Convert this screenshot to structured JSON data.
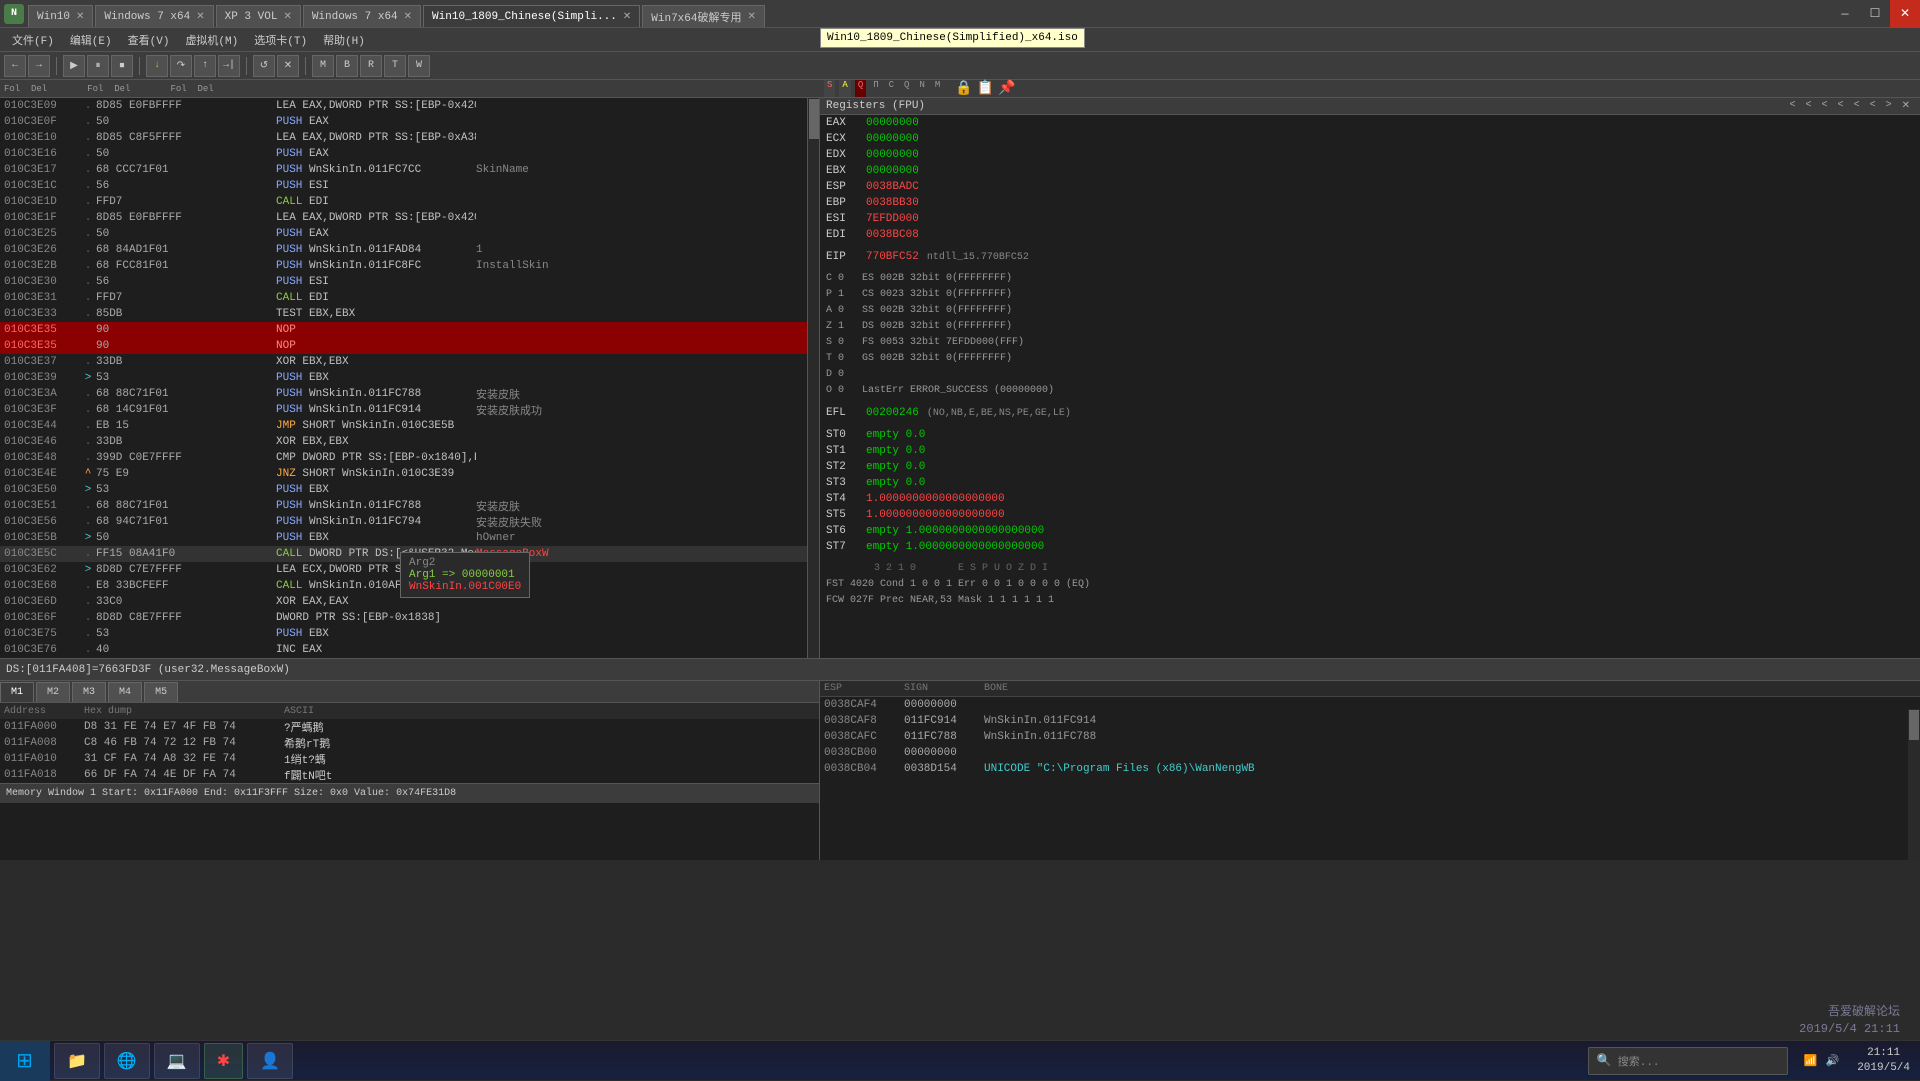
{
  "titlebar": {
    "logo": "N",
    "mode": "NormalMode",
    "tabs": [
      {
        "label": "Win10",
        "active": false
      },
      {
        "label": "Windows 7 x64",
        "active": false
      },
      {
        "label": "XP 3 VOL",
        "active": false
      },
      {
        "label": "Windows 7 x64",
        "active": false
      },
      {
        "label": "Win10_1809_Chinese(Simpli...",
        "active": true
      },
      {
        "label": "Win7x64破解专用",
        "active": false
      }
    ],
    "tooltip": "Win10_1809_Chinese(Simplified)_x64.iso",
    "controls": [
      "—",
      "☐",
      "✕"
    ]
  },
  "menu": {
    "items": [
      "文件(F)",
      "编辑(E)",
      "查看(V)",
      "虚拟机(M)",
      "选项卡(T)",
      "帮助(H)"
    ]
  },
  "col_headers": {
    "fol_del_items": [
      "Fol",
      "Del",
      "Fol",
      "Del",
      "Fol",
      "Del"
    ]
  },
  "registers_panel": {
    "title": "Registers (FPU)",
    "nav_arrows": [
      "<",
      "<",
      "<",
      "<",
      "<",
      "<",
      "<",
      ">"
    ],
    "regs": [
      {
        "name": "EAX",
        "val": "00000000",
        "color": "green"
      },
      {
        "name": "ECX",
        "val": "00000000",
        "color": "green"
      },
      {
        "name": "EDX",
        "val": "00000000",
        "color": "green"
      },
      {
        "name": "EBX",
        "val": "00000000",
        "color": "green"
      },
      {
        "name": "ESP",
        "val": "0038BADC",
        "color": "red"
      },
      {
        "name": "EBP",
        "val": "0038BB30",
        "color": "red"
      },
      {
        "name": "ESI",
        "val": "7EFDD000",
        "color": "red"
      },
      {
        "name": "EDI",
        "val": "0038BC08",
        "color": "red"
      }
    ],
    "eip": {
      "name": "EIP",
      "val": "770BFC52",
      "extra": "ntdll_15.770BFC52"
    },
    "flags": [
      {
        "name": "C 0",
        "detail": "ES 002B 32bit 0(FFFFFFFF)"
      },
      {
        "name": "P 1",
        "detail": "CS 0023 32bit 0(FFFFFFFF)"
      },
      {
        "name": "A 0",
        "detail": "SS 002B 32bit 0(FFFFFFFF)"
      },
      {
        "name": "Z 1",
        "detail": "DS 002B 32bit 0(FFFFFFFF)"
      },
      {
        "name": "S 0",
        "detail": "FS 0053 32bit 7EFDD000(FFF)"
      },
      {
        "name": "T 0",
        "detail": "GS 002B 32bit 0(FFFFFFFF)"
      },
      {
        "name": "D 0",
        "detail": ""
      },
      {
        "name": "O 0",
        "detail": "LastErr ERROR_SUCCESS (00000000)"
      }
    ],
    "efl": {
      "name": "EFL",
      "val": "00200246",
      "extra": "(NO,NB,E,BE,NS,PE,GE,LE)"
    },
    "st_regs": [
      {
        "name": "ST0",
        "val": "empty 0.0"
      },
      {
        "name": "ST1",
        "val": "empty 0.0"
      },
      {
        "name": "ST2",
        "val": "empty 0.0"
      },
      {
        "name": "ST3",
        "val": "empty 0.0"
      },
      {
        "name": "ST4",
        "val": "1.0000000000000000000",
        "color": "red"
      },
      {
        "name": "ST5",
        "val": "1.0000000000000000000",
        "color": "red"
      },
      {
        "name": "ST6",
        "val": "empty 1.0000000000000000000"
      },
      {
        "name": "ST7",
        "val": "empty 1.0000000000000000000"
      }
    ],
    "fst_line": "3 2 1 0       E S P U O Z D I",
    "fst_vals": "FST 4020  Cond 1 0 0 1  Err 0 0 1 0 0 0 0  (EQ)",
    "fcw_vals": "FCW 027F  Prec NEAR,53  Mask   1 1 1 1 1 1"
  },
  "disasm": {
    "lines": [
      {
        "addr": "010C3E09",
        "dot": ".",
        "bytes": "8D85 E0FBFFFF",
        "instr": "LEA EAX,DWORD PTR SS:[EBP-0x420]",
        "comment": ""
      },
      {
        "addr": "010C3E0F",
        "dot": ".",
        "bytes": "50",
        "instr": "PUSH EAX",
        "comment": ""
      },
      {
        "addr": "010C3E10",
        "dot": ".",
        "bytes": "8D85 C8F5FFFF",
        "instr": "LEA EAX,DWORD PTR SS:[EBP-0xA38]",
        "comment": ""
      },
      {
        "addr": "010C3E16",
        "dot": ".",
        "bytes": "50",
        "instr": "PUSH EAX",
        "comment": ""
      },
      {
        "addr": "010C3E17",
        "dot": ".",
        "bytes": "68 CCC71F01",
        "instr": "PUSH WnSkinIn.011FC7CC",
        "comment": "SkinName"
      },
      {
        "addr": "010C3E1C",
        "dot": ".",
        "bytes": "56",
        "instr": "PUSH ESI",
        "comment": ""
      },
      {
        "addr": "010C3E1D",
        "dot": ".",
        "bytes": "FFD7",
        "instr": "CALL EDI",
        "comment": ""
      },
      {
        "addr": "010C3E1F",
        "dot": ".",
        "bytes": "8D85 E0FBFFFF",
        "instr": "LEA EAX,DWORD PTR SS:[EBP-0x420]",
        "comment": ""
      },
      {
        "addr": "010C3E25",
        "dot": ".",
        "bytes": "50",
        "instr": "PUSH EAX",
        "comment": ""
      },
      {
        "addr": "010C3E26",
        "dot": ".",
        "bytes": "68 84AD1F01",
        "instr": "PUSH WnSkinIn.011FAD84",
        "comment": "1"
      },
      {
        "addr": "010C3E2B",
        "dot": ".",
        "bytes": "68 FCC81F01",
        "instr": "PUSH WnSkinIn.011FC8FC",
        "comment": "InstallSkin"
      },
      {
        "addr": "010C3E30",
        "dot": ".",
        "bytes": "56",
        "instr": "PUSH ESI",
        "comment": ""
      },
      {
        "addr": "010C3E31",
        "dot": ".",
        "bytes": "FFD7",
        "instr": "CALL EDI",
        "comment": ""
      },
      {
        "addr": "010C3E33",
        "dot": ".",
        "bytes": "85DB",
        "instr": "TEST EBX,EBX",
        "comment": ""
      },
      {
        "addr": "010C3E35",
        "dot": "",
        "bytes": "90",
        "instr": "NOP",
        "comment": "",
        "highlight": true
      },
      {
        "addr": "010C3E35",
        "dot": "",
        "bytes": "90",
        "instr": "NOP",
        "comment": "",
        "highlight": true,
        "addr2": ""
      },
      {
        "addr": "010C3E37",
        "dot": ".",
        "bytes": "33DB",
        "instr": "XOR EBX,EBX",
        "comment": ""
      },
      {
        "addr": "010C3E39",
        "dot": ">",
        "bytes": "53",
        "instr": "PUSH EBX",
        "comment": ""
      },
      {
        "addr": "010C3E3A",
        "dot": ".",
        "bytes": "68 88C71F01",
        "instr": "PUSH WnSkinIn.011FC788",
        "comment": "安装皮肤"
      },
      {
        "addr": "010C3E3F",
        "dot": ".",
        "bytes": "68 14C91F01",
        "instr": "PUSH WnSkinIn.011FC914",
        "comment": "安装皮肤成功"
      },
      {
        "addr": "010C3E44",
        "dot": ".",
        "bytes": "EB 15",
        "instr": "JMP SHORT WnSkinIn.010C3E5B",
        "comment": ""
      },
      {
        "addr": "010C3E46",
        "dot": ".",
        "bytes": "33DB",
        "instr": "XOR EBX,EBX",
        "comment": ""
      },
      {
        "addr": "010C3E48",
        "dot": ".",
        "bytes": "399D C0E7FFFF",
        "instr": "CMP DWORD PTR SS:[EBP-0x1840],EBX",
        "comment": ""
      },
      {
        "addr": "010C3E4E",
        "dot": "^",
        "bytes": "75 E9",
        "instr": "JNZ SHORT WnSkinIn.010C3E39",
        "comment": ""
      },
      {
        "addr": "010C3E50",
        "dot": ">",
        "bytes": "53",
        "instr": "PUSH EBX",
        "comment": ""
      },
      {
        "addr": "010C3E51",
        "dot": ".",
        "bytes": "68 88C71F01",
        "instr": "PUSH WnSkinIn.011FC788",
        "comment": "安装皮肤"
      },
      {
        "addr": "010C3E56",
        "dot": ".",
        "bytes": "68 94C71F01",
        "instr": "PUSH WnSkinIn.011FC794",
        "comment": "安装皮肤失败"
      },
      {
        "addr": "010C3E5B",
        "dot": ">",
        "bytes": "50",
        "instr": "PUSH EBX",
        "comment": "hOwner"
      },
      {
        "addr": "010C3E5C",
        "dot": ".",
        "bytes": "FF15 08A41F0",
        "instr": "CALL DWORD PTR DS:[<&USER32.MessageBoxW>]",
        "comment": "MessageBoxW",
        "highlight2": true
      },
      {
        "addr": "010C3E62",
        "dot": ">",
        "bytes": "8D8D C7E7FFFF",
        "instr": "LEA ECX,DWORD PTR SS:[EBP-0x1839]",
        "comment": ""
      },
      {
        "addr": "010C3E68",
        "dot": ".",
        "bytes": "E8 33BCFEFF",
        "instr": "CALL WnSkinIn.010AFAA0",
        "comment": ""
      },
      {
        "addr": "010C3E6D",
        "dot": ".",
        "bytes": "33C0",
        "instr": "XOR EAX,EAX",
        "comment": ""
      },
      {
        "addr": "010C3E6F",
        "dot": ".",
        "bytes": "8D8D C8E7FFFF",
        "instr": "DWORD PTR SS:[EBP-0x1838]",
        "comment": ""
      },
      {
        "addr": "010C3E75",
        "dot": ".",
        "bytes": "53",
        "instr": "PUSH EBX",
        "comment": ""
      },
      {
        "addr": "010C3E76",
        "dot": ".",
        "bytes": "40",
        "instr": "INC EAX",
        "comment": ""
      },
      {
        "addr": "010C3E77",
        "dot": ".",
        "bytes": "50",
        "instr": "PUSH EAX",
        "comment": ""
      },
      {
        "addr": "010C3E78",
        "dot": ".",
        "bytes": "E8 63C2FEFF",
        "instr": "CALL WnSkinIn.010B00E0",
        "comment": ""
      }
    ],
    "tooltip_lines": [
      "Arg2",
      "Arg1 => 00000001",
      "WnSkinIn.001C00E0"
    ]
  },
  "status_bar": {
    "text": "DS:[011FA408]=7663FD3F (user32.MessageBoxW)"
  },
  "hex_panel": {
    "tabs": [
      "M1",
      "M2",
      "M3",
      "M4",
      "M5"
    ],
    "active_tab": "M1",
    "lines": [
      {
        "addr": "011FA000",
        "bytes": "D8 31 FE 74  E7 4F FB 74",
        "ascii": "?严螞鹅"
      },
      {
        "addr": "011FA008",
        "bytes": "C8 46 FB 74  72 12 FB 74",
        "ascii": "希鹅rT鹅"
      },
      {
        "addr": "011FA010",
        "bytes": "31 CF FA 74  A8 32 FE 74",
        "ascii": "1绡t?螞"
      },
      {
        "addr": "011FA018",
        "bytes": "66 DF FA 74  4E DF FA 74",
        "ascii": "f闢tN吧t"
      }
    ],
    "bottom_info": "Memory Window 1  Start: 0x11FA000  End: 0x11F3FFF  Size: 0x0  Value: 0x74FE31D8"
  },
  "stack_panel": {
    "lines": [
      {
        "addr": "0038CAF4",
        "val": "00000000",
        "info": ""
      },
      {
        "addr": "0038CAF8",
        "val": "011FC914",
        "info": "WnSkinIn.011FC914"
      },
      {
        "addr": "0038CAFC",
        "val": "011FC788",
        "info": "WnSkinIn.011FC788"
      },
      {
        "addr": "0038CB00",
        "val": "00000000",
        "info": ""
      },
      {
        "addr": "0038CB04",
        "val": "0038D154",
        "info": "UNICODE \"C:\\Program Files (x86)\\WanNengWB",
        "highlight": true
      }
    ]
  },
  "taskbar": {
    "start_icon": "⊞",
    "items": [
      {
        "label": "📁",
        "text": ""
      },
      {
        "label": "🖥",
        "text": ""
      },
      {
        "label": "💻",
        "text": ""
      },
      {
        "label": "✱",
        "text": ""
      },
      {
        "label": "👤",
        "text": ""
      }
    ],
    "tray": {
      "search_placeholder": "🔍",
      "time": "2019/5/4 21:11",
      "sound": "🔊",
      "network": "📶"
    },
    "watermark": "吾爱破解论坛\n2019/5/4 21:11"
  }
}
